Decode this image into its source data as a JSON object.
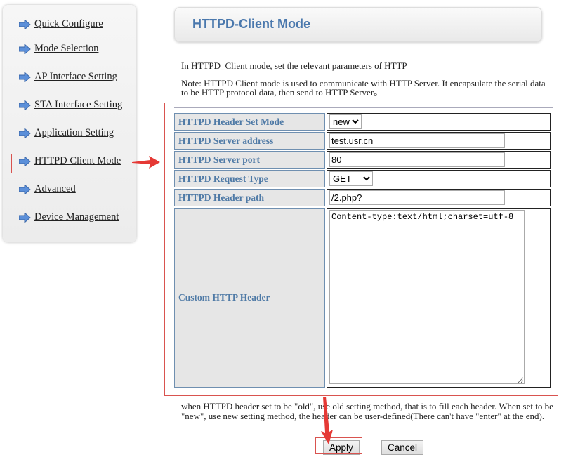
{
  "sidebar": {
    "items": [
      {
        "label": "Quick Configure"
      },
      {
        "label": "Mode Selection"
      },
      {
        "label": "AP Interface Setting"
      },
      {
        "label": "STA Interface Setting"
      },
      {
        "label": "Application Setting"
      },
      {
        "label": "HTTPD Client Mode",
        "highlighted": true
      },
      {
        "label": "Advanced"
      },
      {
        "label": "Device Management"
      }
    ]
  },
  "header": {
    "title": "HTTPD-Client Mode"
  },
  "intro": "In HTTPD_Client mode, set the relevant parameters of HTTP",
  "note": "Note: HTTPD Client mode is used to communicate with HTTP Server. It encapsulate the serial data to be HTTP protocol data, then send to HTTP Server。",
  "form": {
    "header_set_mode": {
      "label": "HTTPD Header Set Mode",
      "value": "new"
    },
    "server_address": {
      "label": "HTTPD Server address",
      "value": "test.usr.cn"
    },
    "server_port": {
      "label": "HTTPD Server port",
      "value": "80"
    },
    "request_type": {
      "label": "HTTPD Request Type",
      "value": "GET"
    },
    "header_path": {
      "label": "HTTPD Header path",
      "value": "/2.php?"
    },
    "custom_header": {
      "label": "Custom HTTP Header",
      "value": "Content-type:text/html;charset=utf-8"
    }
  },
  "footnote": "when HTTPD header set to be \"old\", use old setting method, that is to fill each header. When set to be \"new\", use new setting method, the header can be user-defined(There can't have \"enter\" at the end).",
  "buttons": {
    "apply": "Apply",
    "cancel": "Cancel"
  },
  "colors": {
    "annotation": "#e53935",
    "accent": "#4a78ad"
  }
}
